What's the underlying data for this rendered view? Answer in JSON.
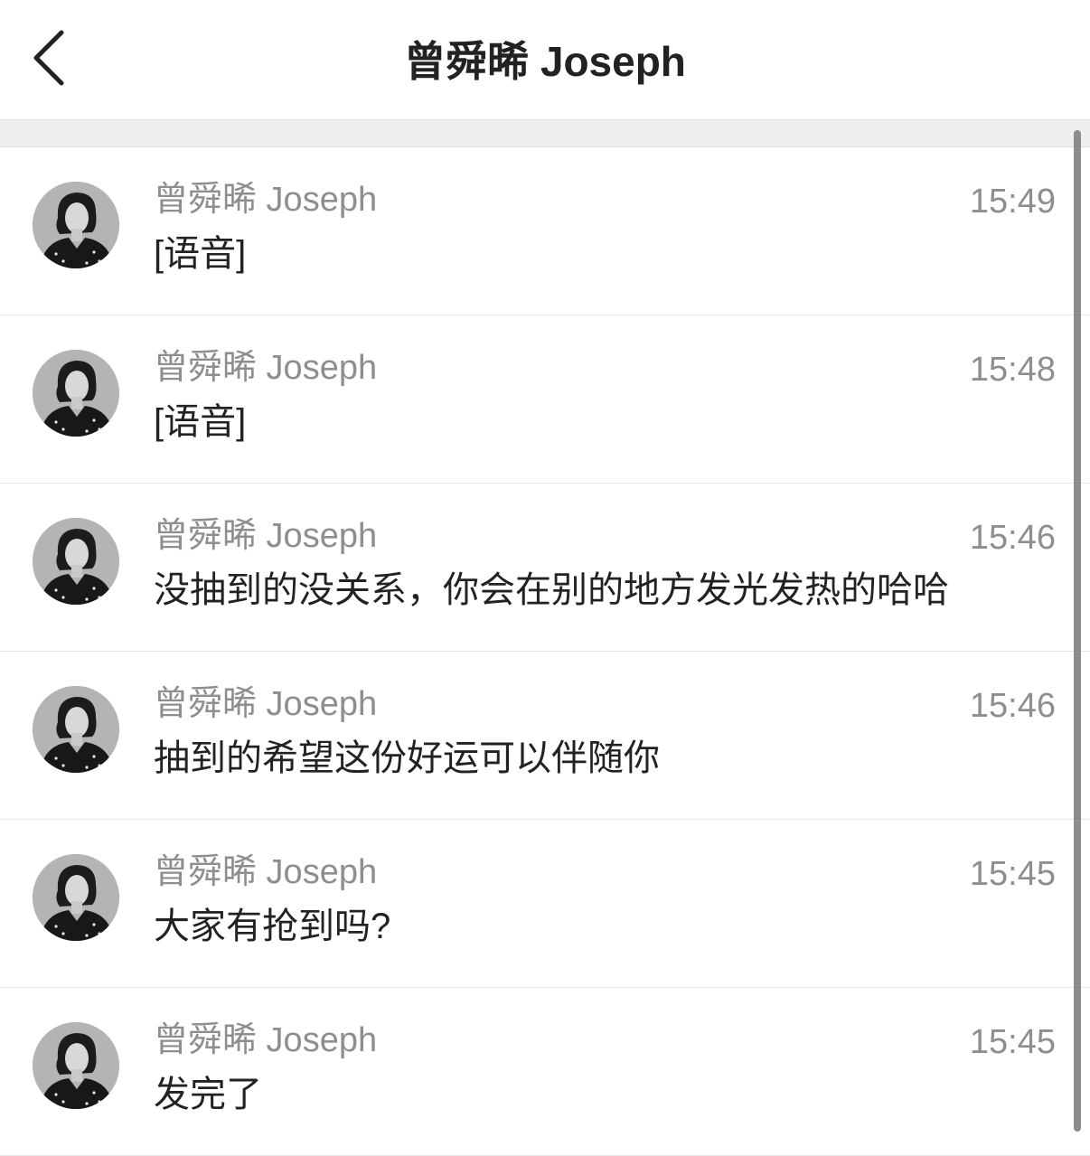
{
  "header": {
    "title": "曾舜晞 Joseph",
    "back_icon": "chevron-left-icon"
  },
  "messages": [
    {
      "sender": "曾舜晞 Joseph",
      "time": "15:49",
      "text": "[语音]"
    },
    {
      "sender": "曾舜晞 Joseph",
      "time": "15:48",
      "text": "[语音]"
    },
    {
      "sender": "曾舜晞 Joseph",
      "time": "15:46",
      "text": "没抽到的没关系，你会在别的地方发光发热的哈哈"
    },
    {
      "sender": "曾舜晞 Joseph",
      "time": "15:46",
      "text": "抽到的希望这份好运可以伴随你"
    },
    {
      "sender": "曾舜晞 Joseph",
      "time": "15:45",
      "text": "大家有抢到吗?"
    },
    {
      "sender": "曾舜晞 Joseph",
      "time": "15:45",
      "text": "发完了"
    }
  ],
  "colors": {
    "background": "#ffffff",
    "separator": "#eeeeee",
    "secondary_text": "#8e8e8e",
    "primary_text": "#222222"
  }
}
